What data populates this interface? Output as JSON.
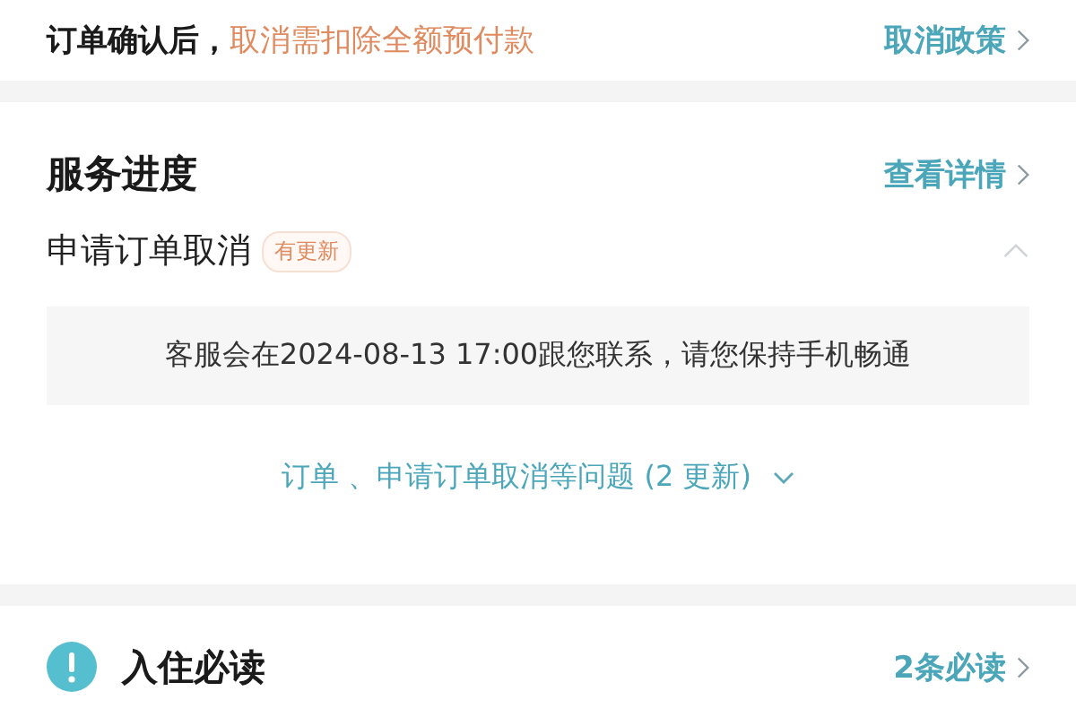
{
  "policy": {
    "lead": "订单确认后，",
    "warning": "取消需扣除全额预付款",
    "link": "取消政策"
  },
  "progress": {
    "title": "服务进度",
    "link": "查看详情",
    "item": {
      "title": "申请订单取消",
      "badge": "有更新",
      "expanded": true,
      "message": "客服会在2024-08-13 17:00跟您联系，请您保持手机畅通"
    },
    "more": "订单 、申请订单取消等问题 (2 更新)"
  },
  "notice": {
    "title": "入住必读",
    "link": "2条必读"
  }
}
